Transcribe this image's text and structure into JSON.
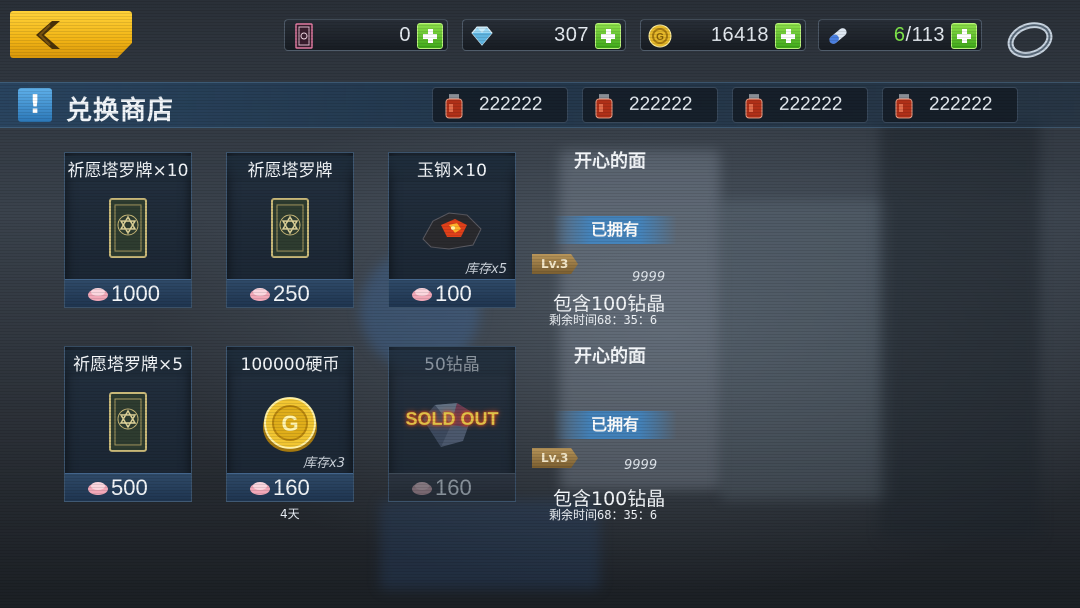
{
  "topbar": {
    "resources": [
      {
        "icon": "tarot-card-icon",
        "value": "0"
      },
      {
        "icon": "diamond-icon",
        "value": "307"
      },
      {
        "icon": "gold-coin-icon",
        "value": "16418"
      },
      {
        "icon": "stamina-capsule-icon",
        "value_current": "6",
        "value_max": "/113"
      }
    ]
  },
  "header": {
    "title": "兑换商店",
    "currencies": [
      "222222",
      "222222",
      "222222",
      "222222"
    ]
  },
  "items": [
    {
      "name": "祈愿塔罗牌×10",
      "price": "1000",
      "icon": "tarot-card-icon"
    },
    {
      "name": "祈愿塔罗牌",
      "price": "250",
      "icon": "tarot-card-icon"
    },
    {
      "name": "玉钢×10",
      "price": "100",
      "stock": "库存x5",
      "icon": "ore-icon"
    },
    {
      "name": "祈愿塔罗牌×5",
      "price": "500",
      "icon": "tarot-card-icon"
    },
    {
      "name": "100000硬币",
      "price": "160",
      "stock": "库存x3",
      "days": "4天",
      "icon": "gold-coin-icon"
    },
    {
      "name": "50钻晶",
      "price": "160",
      "sold_out": "SOLD OUT",
      "icon": "diamond-icon"
    }
  ],
  "side_panels": [
    {
      "title": "开心的面",
      "owned": "已拥有",
      "level": "Lv.3",
      "count": "9999",
      "contains": "包含100钻晶",
      "remaining": "剩余时间68：35：6"
    },
    {
      "title": "开心的面",
      "owned": "已拥有",
      "level": "Lv.3",
      "count": "9999",
      "contains": "包含100钻晶",
      "remaining": "剩余时间68：35：6"
    }
  ],
  "colors": {
    "accent_yellow": "#f2b516",
    "plus_green": "#3fa81a",
    "header_blue": "#2c78b8"
  }
}
